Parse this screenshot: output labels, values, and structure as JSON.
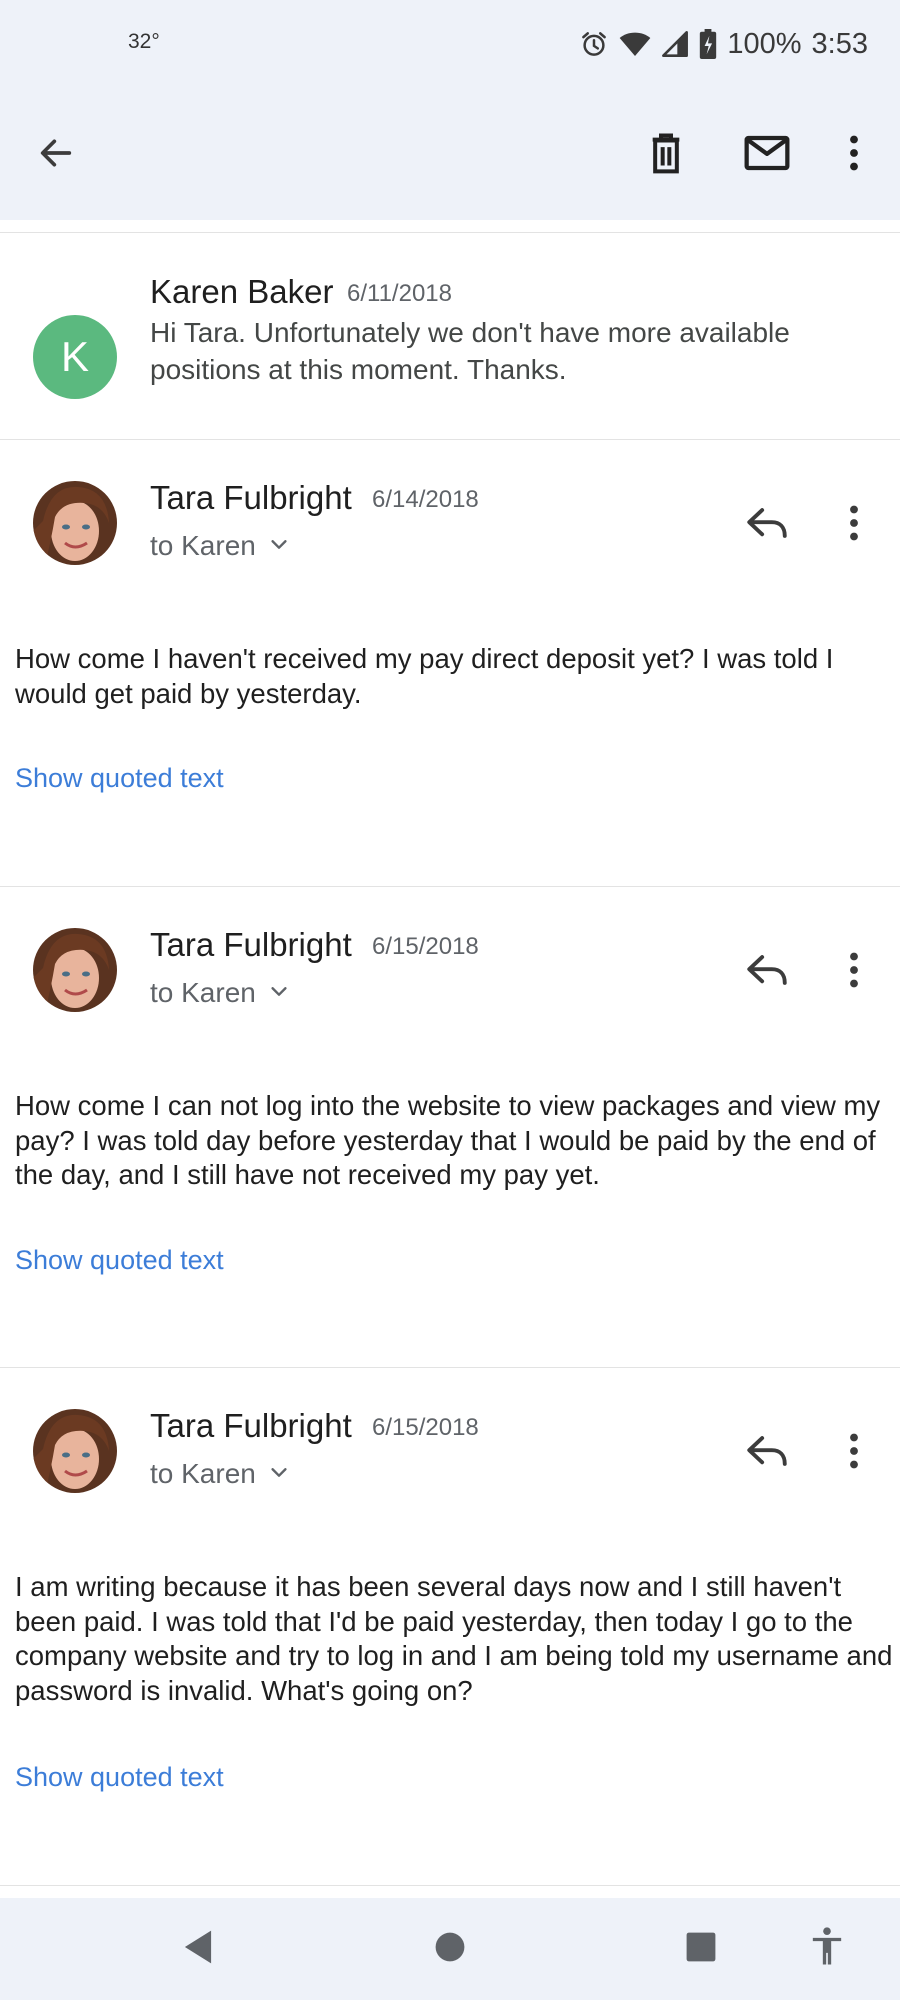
{
  "status_bar": {
    "temperature": "32°",
    "battery": "100%",
    "time": "3:53"
  },
  "app_bar": {
    "back_icon": "arrow-left-icon",
    "delete_icon": "trash-icon",
    "mark_unread_icon": "mail-icon",
    "more_icon": "more-vert-icon"
  },
  "messages": [
    {
      "avatar_letter": "K",
      "avatar_color": "#5bb97f",
      "sender": "Karen Baker",
      "date": "6/11/2018",
      "snippet": "Hi Tara. Unfortunately we don't have more available positions at this moment. Thanks."
    },
    {
      "sender": "Tara Fulbright",
      "date": "6/14/2018",
      "to": "to Karen",
      "body": "How come I haven't received my pay direct deposit yet? I was told I would get paid by yesterday.",
      "quoted_link": "Show quoted text"
    },
    {
      "sender": "Tara Fulbright",
      "date": "6/15/2018",
      "to": "to Karen",
      "body": "How come I can not log into the website to view packages and view my pay? I was told day before yesterday that I would be paid by the end of the day, and I still have not received my pay yet.",
      "quoted_link": "Show quoted text"
    },
    {
      "sender": "Tara Fulbright",
      "date": "6/15/2018",
      "to": "to Karen",
      "body": "I am writing because it has been several days now and I still haven't been paid.  I was told that I'd be paid yesterday,  then today I go to the company website and try to log in and I am being told my username and password is invalid. What's going on?",
      "quoted_link": "Show quoted text"
    }
  ],
  "nav_bar": {
    "back_icon": "nav-back-icon",
    "home_icon": "nav-home-icon",
    "recents_icon": "nav-recents-icon",
    "accessibility_icon": "accessibility-icon"
  }
}
